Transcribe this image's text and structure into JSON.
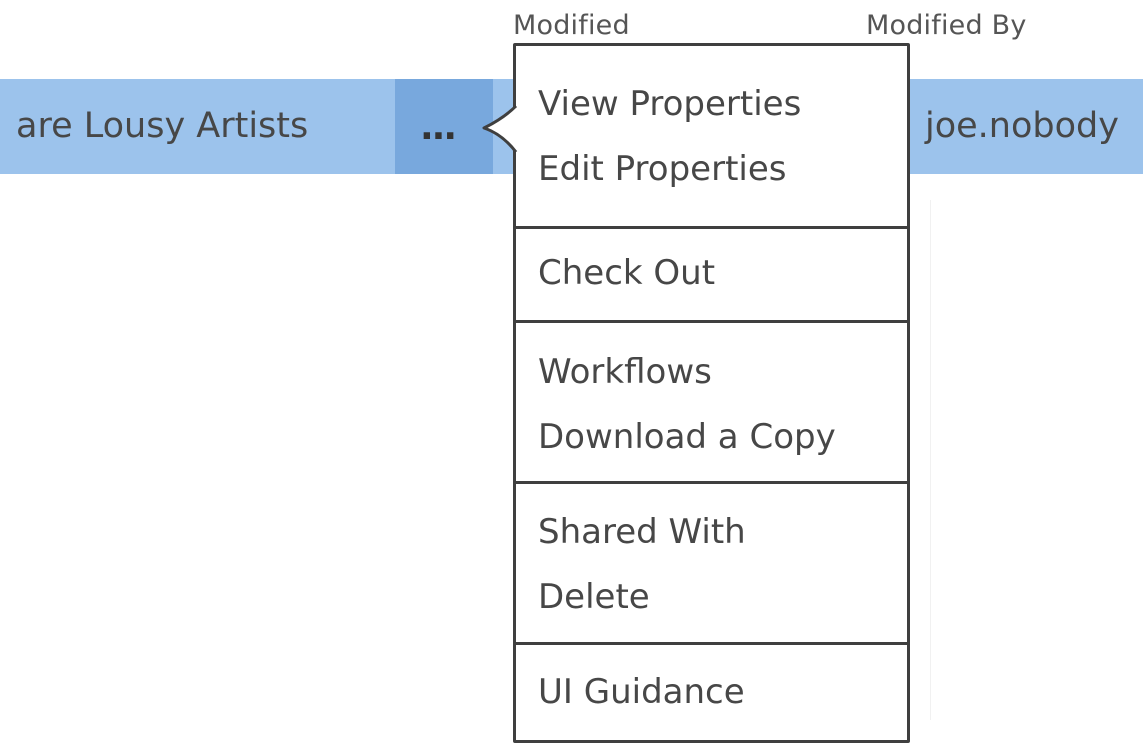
{
  "headers": {
    "modified": "Modified",
    "modified_by": "Modified By"
  },
  "row": {
    "name": "are Lousy Artists",
    "ellipsis": "...",
    "modified_by": "joe.nobody"
  },
  "menu": {
    "sections": [
      [
        "View Properties",
        "Edit Properties"
      ],
      [
        "Check Out"
      ],
      [
        "Workflows",
        "Download a Copy"
      ],
      [
        "Shared With",
        "Delete"
      ],
      [
        "UI Guidance"
      ]
    ]
  },
  "colors": {
    "row_selected": "#9cc3ec",
    "ellipsis_active": "#78a8dd",
    "menu_border": "#3f3f3f"
  }
}
